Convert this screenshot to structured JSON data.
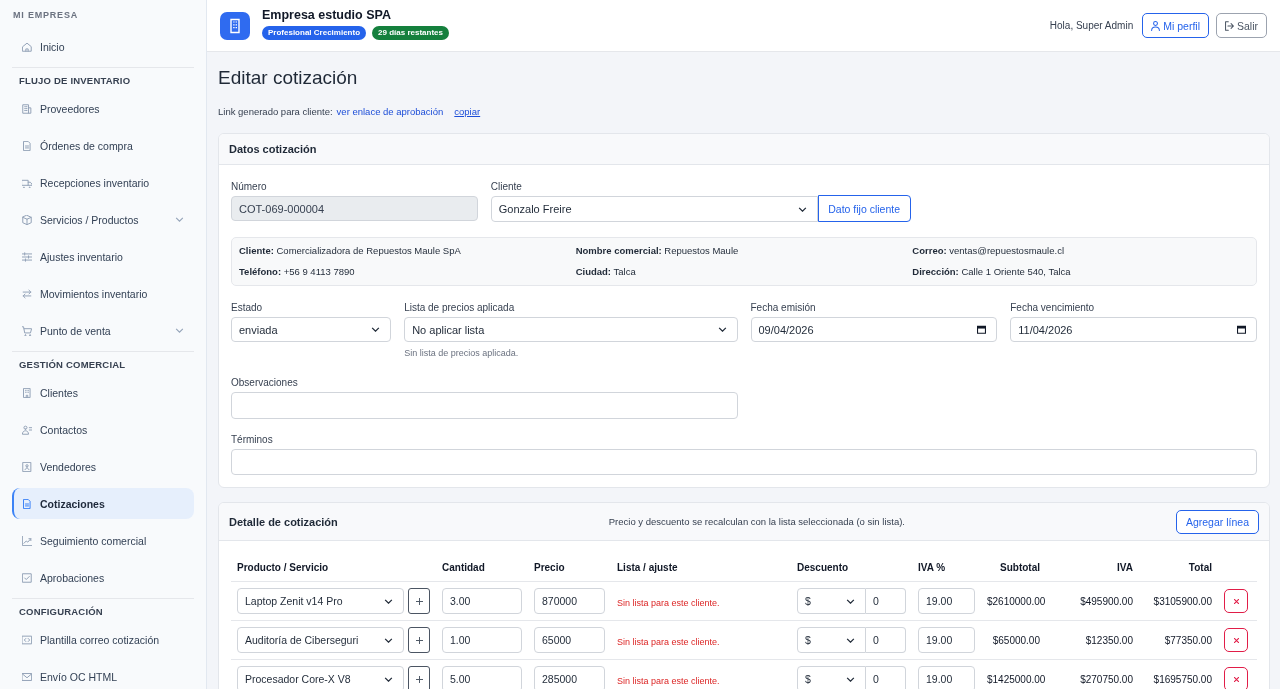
{
  "sidebar": {
    "sections": [
      {
        "title": "MI EMPRESA",
        "items": [
          {
            "label": "Inicio",
            "kind": "link",
            "selected": false
          }
        ]
      },
      {
        "title": "FLUJO DE INVENTARIO",
        "items": [
          {
            "label": "Proveedores",
            "kind": "link",
            "selected": false
          },
          {
            "label": "Órdenes de compra",
            "kind": "link",
            "selected": false
          },
          {
            "label": "Recepciones inventario",
            "kind": "link",
            "selected": false
          },
          {
            "label": "Servicios / Productos",
            "kind": "submenu",
            "expanded": false,
            "selected": false
          },
          {
            "label": "Ajustes inventario",
            "kind": "link",
            "selected": false
          },
          {
            "label": "Movimientos inventario",
            "kind": "link",
            "selected": false
          },
          {
            "label": "Punto de venta",
            "kind": "submenu",
            "expanded": false,
            "selected": false
          }
        ]
      },
      {
        "title": "GESTIÓN COMERCIAL",
        "items": [
          {
            "label": "Clientes",
            "kind": "link",
            "selected": false
          },
          {
            "label": "Contactos",
            "kind": "link",
            "selected": false
          },
          {
            "label": "Vendedores",
            "kind": "link",
            "selected": false
          },
          {
            "label": "Cotizaciones",
            "kind": "link",
            "selected": true
          },
          {
            "label": "Seguimiento comercial",
            "kind": "link",
            "selected": false
          },
          {
            "label": "Aprobaciones",
            "kind": "link",
            "selected": false
          }
        ]
      },
      {
        "title": "CONFIGURACIÓN",
        "items": [
          {
            "label": "Plantilla correo cotización",
            "kind": "link",
            "selected": false
          },
          {
            "label": "Envío OC HTML",
            "kind": "link",
            "selected": false
          }
        ]
      }
    ]
  },
  "header": {
    "company": "Empresa estudio SPA",
    "badges": [
      {
        "label": "Profesional Crecimiento",
        "color": "#2563eb"
      },
      {
        "label": "29 días restantes",
        "color": "#15803d"
      }
    ],
    "greeting": "Hola, Super Admin",
    "buttons": [
      {
        "label": "Mi perfil",
        "kind": "profile"
      },
      {
        "label": "Salir",
        "kind": "logout"
      }
    ]
  },
  "page": {
    "title": "Editar cotización",
    "link_line": {
      "text": "Link generado para cliente:",
      "link": "ver enlace de aprobación",
      "action": "copiar"
    }
  },
  "quote_data": {
    "title": "Datos cotización",
    "number": {
      "label": "Número",
      "value": "COT-069-000004",
      "disabled": true
    },
    "client": {
      "label": "Cliente",
      "value": "Gonzalo Freire",
      "button": "Dato fijo cliente"
    },
    "client_info": [
      "**Cliente:** Comercializadora de Repuestos Maule SpA",
      "**Nombre comercial:** Repuestos Maule",
      "**Correo:** ventas@repuestosmaule.cl",
      "**Teléfono:** +56 9 4113 7890",
      "**Ciudad:** Talca",
      "**Dirección:** Calle 1 Oriente 540, Talca"
    ],
    "status": {
      "label": "Estado",
      "value": "enviada"
    },
    "price_list": {
      "label": "Lista de precios aplicada",
      "value": "No aplicar lista",
      "help": "Sin lista de precios aplicada."
    },
    "issue_date": {
      "label": "Fecha emisión",
      "value": "09/04/2026"
    },
    "due_date": {
      "label": "Fecha vencimiento",
      "value": "11/04/2026"
    },
    "notes": {
      "label": "Observaciones"
    },
    "terms": {
      "label": "Términos"
    }
  },
  "detail": {
    "title": "Detalle de cotización",
    "note": "Precio y descuento se recalculan con la lista seleccionada (o sin lista).",
    "add_button": "Agregar línea",
    "columns": [
      "Producto / Servicio",
      "Cantidad",
      "Precio",
      "Lista / ajuste",
      "Descuento",
      "IVA %",
      "Subtotal",
      "IVA",
      "Total"
    ],
    "rows": [
      {
        "product": "Laptop Zenit v14 Pro",
        "quantity": "3.00",
        "price": "870000",
        "list_note": "Sin lista para este cliente.",
        "discount_type": "$",
        "discount": "0",
        "iva_rate": "19.00",
        "subtotal": "$2610000.00",
        "iva": "$495900.00",
        "total": "$3105900.00"
      },
      {
        "product": "Auditoría de Ciberseguri",
        "quantity": "1.00",
        "price": "65000",
        "list_note": "Sin lista para este cliente.",
        "discount_type": "$",
        "discount": "0",
        "iva_rate": "19.00",
        "subtotal": "$65000.00",
        "iva": "$12350.00",
        "total": "$77350.00"
      },
      {
        "product": "Procesador Core-X V8",
        "quantity": "5.00",
        "price": "285000",
        "list_note": "Sin lista para este cliente.",
        "discount_type": "$",
        "discount": "0",
        "iva_rate": "19.00",
        "subtotal": "$1425000.00",
        "iva": "$270750.00",
        "total": "$1695750.00"
      }
    ]
  }
}
